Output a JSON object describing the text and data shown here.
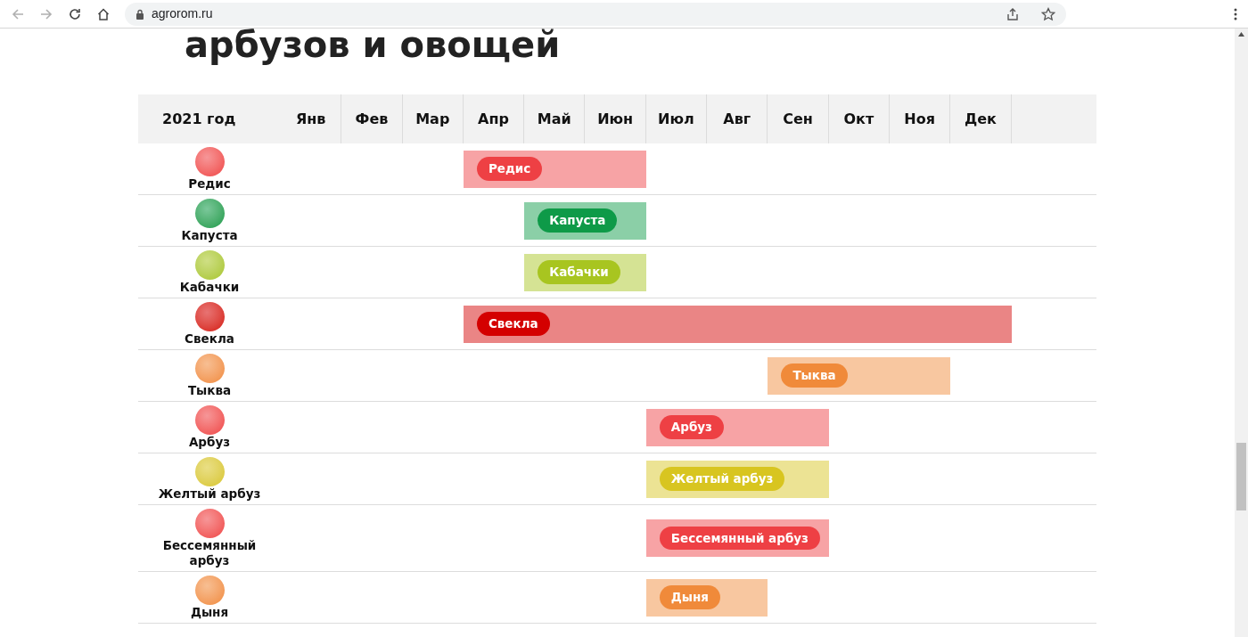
{
  "browser": {
    "address": "agrorom.ru"
  },
  "heading": "арбузов и овощей",
  "calendar": {
    "year_label": "2021 год",
    "months": [
      "Янв",
      "Фев",
      "Мар",
      "Апр",
      "Май",
      "Июн",
      "Июл",
      "Авг",
      "Сен",
      "Окт",
      "Ноя",
      "Дек"
    ],
    "crops": [
      {
        "name": "Редис",
        "bar_label": "Редис",
        "color": "#ee4044",
        "months_active": [
          false,
          false,
          false,
          true,
          true,
          true,
          false,
          false,
          false,
          false,
          false,
          false
        ]
      },
      {
        "name": "Капуста",
        "bar_label": "Капуста",
        "color": "#0e9a48",
        "months_active": [
          false,
          false,
          false,
          false,
          true,
          true,
          false,
          false,
          false,
          false,
          false,
          false
        ]
      },
      {
        "name": "Кабачки",
        "bar_label": "Кабачки",
        "color": "#a8c520",
        "months_active": [
          false,
          false,
          false,
          false,
          true,
          true,
          false,
          false,
          false,
          false,
          false,
          false
        ]
      },
      {
        "name": "Свекла",
        "bar_label": "Свекла",
        "color": "#d40000",
        "months_active": [
          false,
          false,
          false,
          true,
          true,
          true,
          true,
          true,
          true,
          true,
          true,
          true
        ]
      },
      {
        "name": "Тыква",
        "bar_label": "Тыква",
        "color": "#f08a3a",
        "months_active": [
          false,
          false,
          false,
          false,
          false,
          false,
          false,
          false,
          true,
          true,
          true,
          false
        ]
      },
      {
        "name": "Арбуз",
        "bar_label": "Арбуз",
        "color": "#ee4044",
        "months_active": [
          false,
          false,
          false,
          false,
          false,
          false,
          true,
          true,
          true,
          false,
          false,
          false
        ]
      },
      {
        "name": "Желтый арбуз",
        "bar_label": "Желтый арбуз",
        "color": "#d8c520",
        "months_active": [
          false,
          false,
          false,
          false,
          false,
          false,
          true,
          true,
          true,
          false,
          false,
          false
        ]
      },
      {
        "name": "Бессемянный арбуз",
        "bar_label": "Бессемянный арбуз",
        "color": "#ee4044",
        "months_active": [
          false,
          false,
          false,
          false,
          false,
          false,
          true,
          true,
          true,
          false,
          false,
          false
        ]
      },
      {
        "name": "Дыня",
        "bar_label": "Дыня",
        "color": "#f08a3a",
        "months_active": [
          false,
          false,
          false,
          false,
          false,
          false,
          true,
          true,
          false,
          false,
          false,
          false
        ]
      }
    ]
  }
}
